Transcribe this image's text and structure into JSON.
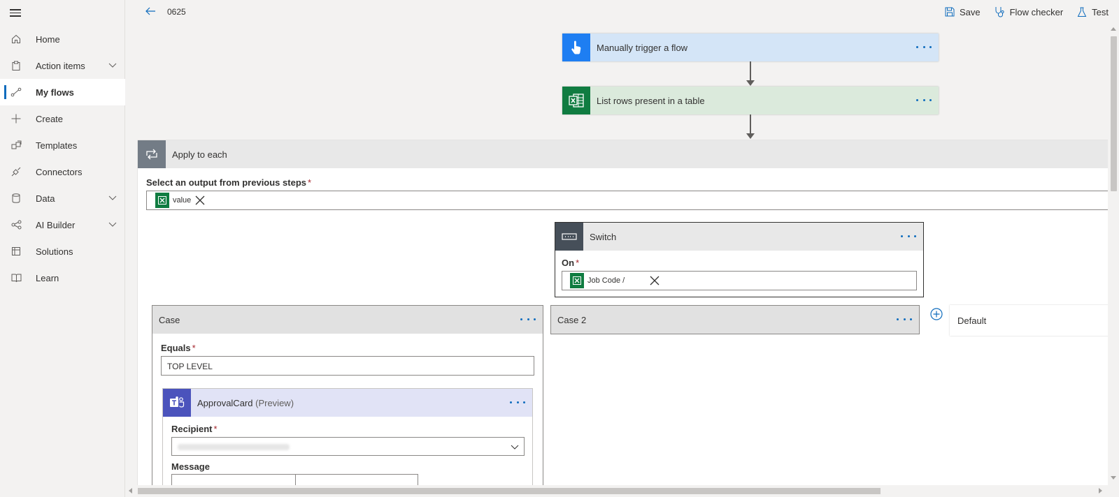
{
  "sidebar": {
    "items": [
      {
        "label": "Home",
        "icon": "home-icon",
        "chevron": false,
        "active": false
      },
      {
        "label": "Action items",
        "icon": "clipboard-icon",
        "chevron": true,
        "active": false
      },
      {
        "label": "My flows",
        "icon": "flow-icon",
        "chevron": false,
        "active": true
      },
      {
        "label": "Create",
        "icon": "plus-icon",
        "chevron": false,
        "active": false
      },
      {
        "label": "Templates",
        "icon": "templates-icon",
        "chevron": false,
        "active": false
      },
      {
        "label": "Connectors",
        "icon": "connector-icon",
        "chevron": false,
        "active": false
      },
      {
        "label": "Data",
        "icon": "database-icon",
        "chevron": true,
        "active": false
      },
      {
        "label": "AI Builder",
        "icon": "ai-builder-icon",
        "chevron": true,
        "active": false
      },
      {
        "label": "Solutions",
        "icon": "solutions-icon",
        "chevron": false,
        "active": false
      },
      {
        "label": "Learn",
        "icon": "book-icon",
        "chevron": false,
        "active": false
      }
    ]
  },
  "topbar": {
    "flow_name": "0625",
    "save_label": "Save",
    "checker_label": "Flow checker",
    "test_label": "Test"
  },
  "flow": {
    "trigger": {
      "title": "Manually trigger a flow"
    },
    "list_rows": {
      "title": "List rows present in a table"
    },
    "apply_each": {
      "title": "Apply to each",
      "output_label": "Select an output from previous steps",
      "output_token": "value"
    },
    "switch": {
      "title": "Switch",
      "on_label": "On",
      "on_token": "Job Code /"
    },
    "case1": {
      "title": "Case",
      "equals_label": "Equals",
      "equals_value": "TOP LEVEL"
    },
    "case2": {
      "title": "Case 2"
    },
    "default": {
      "title": "Default"
    },
    "approval": {
      "title": "ApprovalCard",
      "title_suffix": "(Preview)",
      "recipient_label": "Recipient",
      "message_label": "Message"
    }
  },
  "colors": {
    "accent": "#0f6cbd",
    "trigger_bg": "#d4e5f7",
    "trigger_icon": "#1e7ef2",
    "excel_green": "#107c41",
    "excel_bg": "#dbeadc",
    "apply_icon": "#737c86",
    "switch_icon": "#464f59",
    "teams_purple": "#4b53bc",
    "teams_bg": "#e1e3f6",
    "case_bg": "#e1e1e1"
  }
}
